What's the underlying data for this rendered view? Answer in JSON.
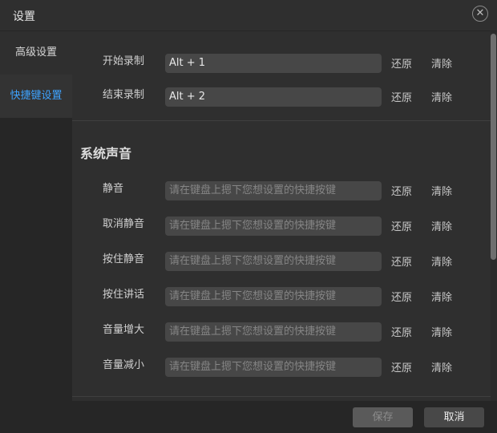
{
  "window": {
    "title": "设置"
  },
  "icons": {
    "close": "close-icon"
  },
  "sidebar": {
    "items": [
      {
        "label": "高级设置",
        "active": false
      },
      {
        "label": "快捷键设置",
        "active": true
      }
    ],
    "active_color": "#3ea3ff"
  },
  "recording": [
    {
      "label": "开始录制",
      "value": "Alt + 1",
      "restore": "还原",
      "clear": "清除"
    },
    {
      "label": "结束录制",
      "value": "Alt + 2",
      "restore": "还原",
      "clear": "清除"
    }
  ],
  "system_sound": {
    "title": "系统声音",
    "rows": [
      {
        "label": "静音",
        "placeholder": "请在键盘上摁下您想设置的快捷按键",
        "restore": "还原",
        "clear": "清除"
      },
      {
        "label": "取消静音",
        "placeholder": "请在键盘上摁下您想设置的快捷按键",
        "restore": "还原",
        "clear": "清除"
      },
      {
        "label": "按住静音",
        "placeholder": "请在键盘上摁下您想设置的快捷按键",
        "restore": "还原",
        "clear": "清除"
      },
      {
        "label": "按住讲话",
        "placeholder": "请在键盘上摁下您想设置的快捷按键",
        "restore": "还原",
        "clear": "清除"
      },
      {
        "label": "音量增大",
        "placeholder": "请在键盘上摁下您想设置的快捷按键",
        "restore": "还原",
        "clear": "清除"
      },
      {
        "label": "音量减小",
        "placeholder": "请在键盘上摁下您想设置的快捷按键",
        "restore": "还原",
        "clear": "清除"
      }
    ]
  },
  "footer": {
    "save_label": "保存",
    "cancel_label": "取消",
    "save_enabled": false
  }
}
